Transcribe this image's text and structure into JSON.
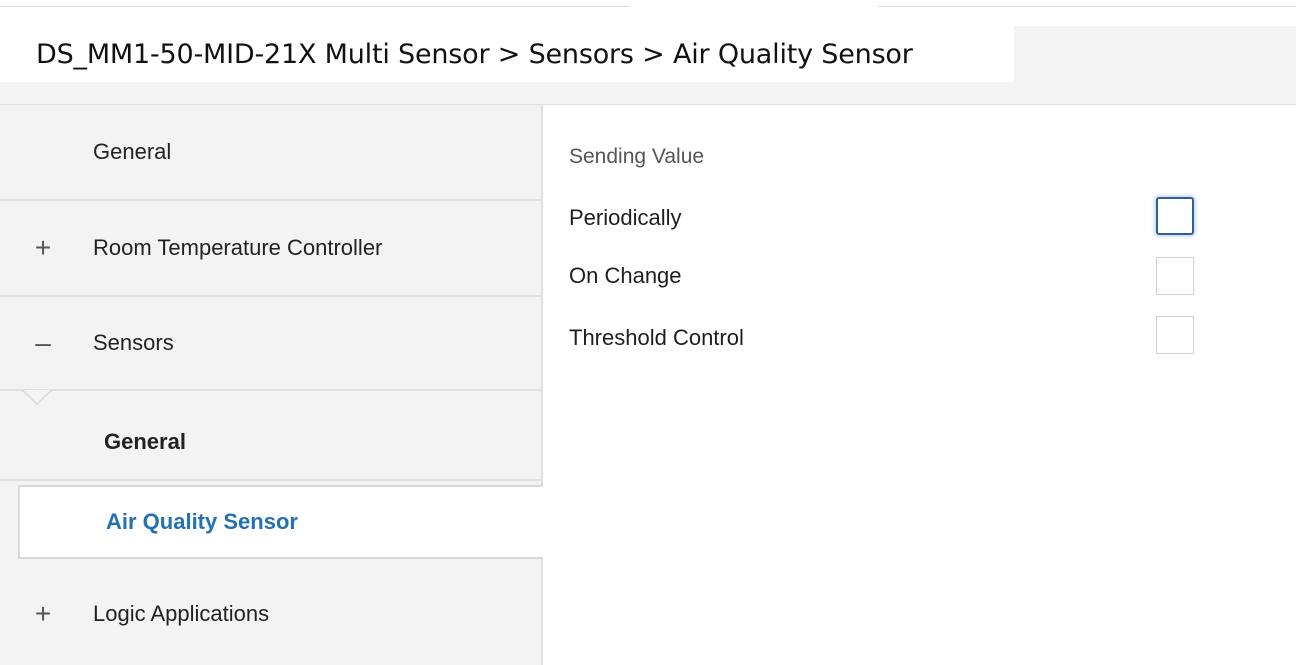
{
  "header": {
    "breadcrumb": "DS_MM1-50-MID-21X Multi Sensor > Sensors > Air Quality Sensor"
  },
  "sidebar": {
    "items": [
      {
        "label": "General",
        "toggle": ""
      },
      {
        "label": "Room Temperature Controller",
        "toggle": "+"
      },
      {
        "label": "Sensors",
        "toggle": "–"
      },
      {
        "label": "General",
        "toggle": ""
      },
      {
        "label": "Air Quality Sensor",
        "toggle": "",
        "selected": true
      },
      {
        "label": "Logic Applications",
        "toggle": "+"
      }
    ]
  },
  "content": {
    "section_title": "Sending Value",
    "options": [
      {
        "label": "Periodically",
        "checked": false,
        "focused": true
      },
      {
        "label": "On Change",
        "checked": false,
        "focused": false
      },
      {
        "label": "Threshold Control",
        "checked": false,
        "focused": false
      }
    ]
  },
  "colors": {
    "selected_text": "#2470b3",
    "focus_border": "#2f5f9e",
    "sidebar_bg": "#f3f3f3"
  }
}
